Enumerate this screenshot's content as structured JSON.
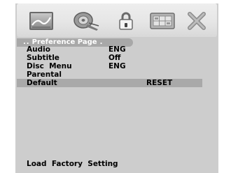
{
  "section_title": "Preference Page",
  "icons": [
    {
      "name": "general-setup-icon"
    },
    {
      "name": "audio-setup-icon"
    },
    {
      "name": "lock-icon"
    },
    {
      "name": "video-setup-icon"
    },
    {
      "name": "exit-icon"
    }
  ],
  "settings": [
    {
      "label": "Audio",
      "value": "ENG"
    },
    {
      "label": "Subtitle",
      "value": "Off"
    },
    {
      "label": "Disc  Menu",
      "value": "ENG"
    },
    {
      "label": "Parental",
      "value": ""
    },
    {
      "label": "Default",
      "value": "RESET"
    }
  ],
  "status_text": "Load  Factory  Setting",
  "colors": {
    "panel": "#cdcdcd",
    "highlight": "#a9a9a9",
    "header_tab": "#a8a8a8",
    "text": "#000000",
    "header_text": "#ffffff"
  }
}
